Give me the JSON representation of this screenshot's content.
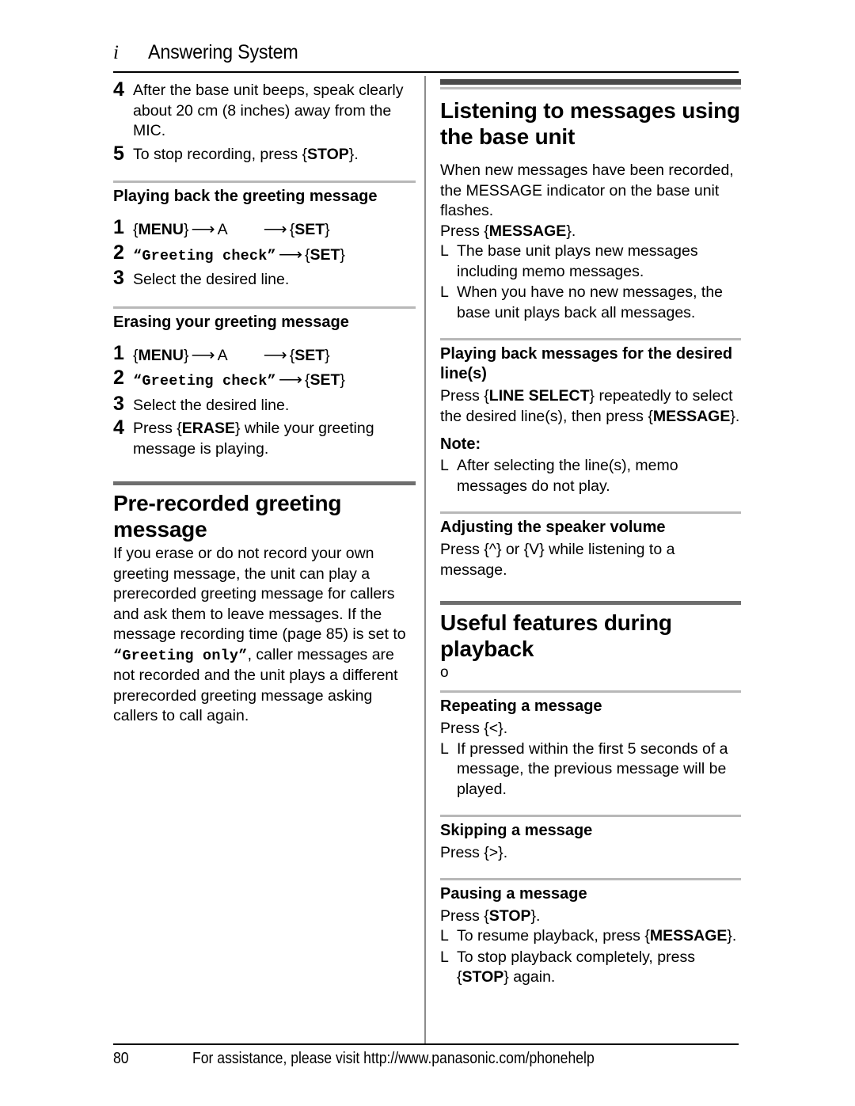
{
  "header": {
    "marker": "i",
    "title": "Answering System"
  },
  "left_column": {
    "steps_top": [
      {
        "num": "4",
        "text": "After the base unit beeps, speak clearly about 20 cm (8 inches) away from the MIC."
      },
      {
        "num": "5",
        "text_before": "To stop recording, press ",
        "key": "STOP",
        "text_after": "."
      }
    ],
    "playing_back_section": {
      "heading": "Playing back the greeting message",
      "step1": {
        "num": "1",
        "key1": "MENU",
        "mid": "A",
        "key2": "SET"
      },
      "step2": {
        "num": "2",
        "lcd": "Greeting check",
        "key": "SET"
      },
      "step3": {
        "num": "3",
        "text": "Select the desired line."
      }
    },
    "erasing_section": {
      "heading": "Erasing your greeting message",
      "step1": {
        "num": "1",
        "key1": "MENU",
        "mid": "A",
        "key2": "SET"
      },
      "step2": {
        "num": "2",
        "lcd": "Greeting check",
        "key": "SET"
      },
      "step3": {
        "num": "3",
        "text": "Select the desired line."
      },
      "step4": {
        "num": "4",
        "text_before": "Press ",
        "key": "ERASE",
        "text_after": " while your greeting message is playing."
      }
    },
    "prerecorded_section": {
      "heading": "Pre-recorded greeting message",
      "body_part1": "If you erase or do not record your own greeting message, the unit can play a prerecorded greeting message for callers and ask them to leave messages. If the message recording time (page 85) is set to ",
      "body_lcd": "Greeting only",
      "body_part2": ", caller messages are not recorded and the unit plays a different prerecorded greeting message asking callers to call again."
    }
  },
  "right_column": {
    "listening_section": {
      "title": "Listening to messages using the base unit",
      "intro": "When new messages have been recorded, the MESSAGE indicator on the base unit flashes.",
      "press_label": "Press ",
      "press_key": "MESSAGE",
      "press_after": ".",
      "bullets": [
        {
          "mark": "L",
          "text": "The base unit plays new messages including memo messages."
        },
        {
          "mark": "L",
          "text": "When you have no new messages, the base unit plays back all messages."
        }
      ]
    },
    "desired_lines_section": {
      "heading": "Playing back messages for the desired line(s)",
      "body_before": "Press ",
      "key1": "LINE SELECT",
      "body_mid": " repeatedly to select the desired line(s), then press ",
      "key2": "MESSAGE",
      "body_after": ".",
      "note_title": "Note:",
      "note_bullets": [
        {
          "mark": "L",
          "text": "After selecting the line(s), memo messages do not play."
        }
      ]
    },
    "volume_section": {
      "heading": "Adjusting the speaker volume",
      "body_before": "Press ",
      "key1": "^",
      "body_mid": " or ",
      "key2": "V",
      "body_after": " while listening to a message."
    },
    "useful_features_section": {
      "title": "Useful features during playback",
      "stray_char": "o"
    },
    "repeating_section": {
      "heading": "Repeating a message",
      "press_before": "Press ",
      "press_key": "<",
      "press_after": ".",
      "bullets": [
        {
          "mark": "L",
          "text": "If pressed within the first 5 seconds of a message, the previous message will be played."
        }
      ]
    },
    "skipping_section": {
      "heading": "Skipping a message",
      "press_before": "Press ",
      "press_key": ">",
      "press_after": "."
    },
    "pausing_section": {
      "heading": "Pausing a message",
      "press_before": "Press ",
      "press_key": "STOP",
      "press_after": ".",
      "bullets": [
        {
          "mark": "L",
          "text_before": "To resume playback, press ",
          "key": "MESSAGE",
          "text_after": "."
        },
        {
          "mark": "L",
          "text_before": "To stop playback completely, press ",
          "key": "STOP",
          "text_after": " again."
        }
      ]
    }
  },
  "footer": {
    "page_number": "80",
    "text": "For assistance, please visit http://www.panasonic.com/phonehelp"
  }
}
